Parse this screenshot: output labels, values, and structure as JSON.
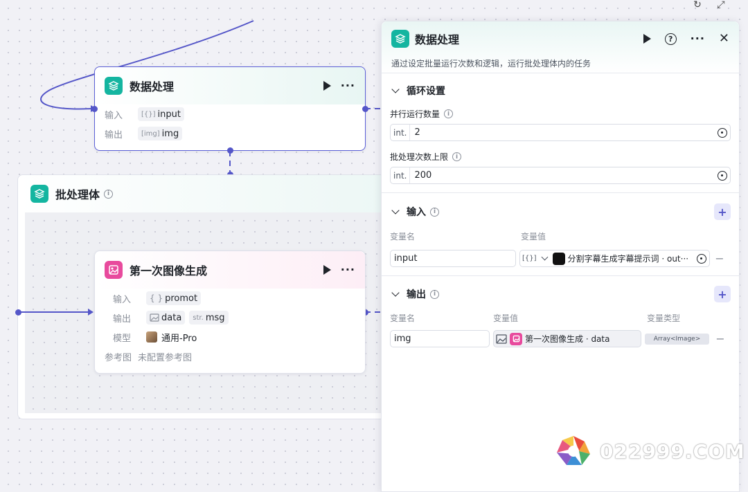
{
  "canvas": {
    "refresh_icon": "refresh-icon",
    "expand_icon": "expand-icon"
  },
  "node_data": {
    "title": "数据处理",
    "input_label": "输入",
    "input_type": "[{}]",
    "input_value": "input",
    "output_label": "输出",
    "output_type": "[img]",
    "output_value": "img"
  },
  "batch": {
    "title": "批处理体"
  },
  "node_image": {
    "title": "第一次图像生成",
    "input_label": "输入",
    "input_type": "{ }",
    "input_value": "promot",
    "output_label": "输出",
    "output1_value": "data",
    "output2_type": "str.",
    "output2_value": "msg",
    "model_label": "模型",
    "model_value": "通用-Pro",
    "ref_label": "参考图",
    "ref_value": "未配置参考图"
  },
  "panel": {
    "title": "数据处理",
    "description": "通过设定批量运行次数和逻辑，运行批处理体内的任务",
    "loop_section": "循环设置",
    "parallel_label": "并行运行数量",
    "parallel_prefix": "int.",
    "parallel_value": "2",
    "limit_label": "批处理次数上限",
    "limit_prefix": "int.",
    "limit_value": "200",
    "input_section": "输入",
    "col_var_name": "变量名",
    "col_var_value": "变量值",
    "input_var_name": "input",
    "input_var_type": "[{}]",
    "input_var_ref": "分割字幕生成字幕提示词 · out···",
    "output_section": "输出",
    "col_var_type": "变量类型",
    "output_var_name": "img",
    "output_var_ref": "第一次图像生成 · data",
    "output_var_type": "Array<Image>"
  },
  "watermark": {
    "text": "022999.COM"
  },
  "colors": {
    "accent": "#5456c8",
    "teal": "#14b5a0",
    "pink": "#e84a9d"
  }
}
